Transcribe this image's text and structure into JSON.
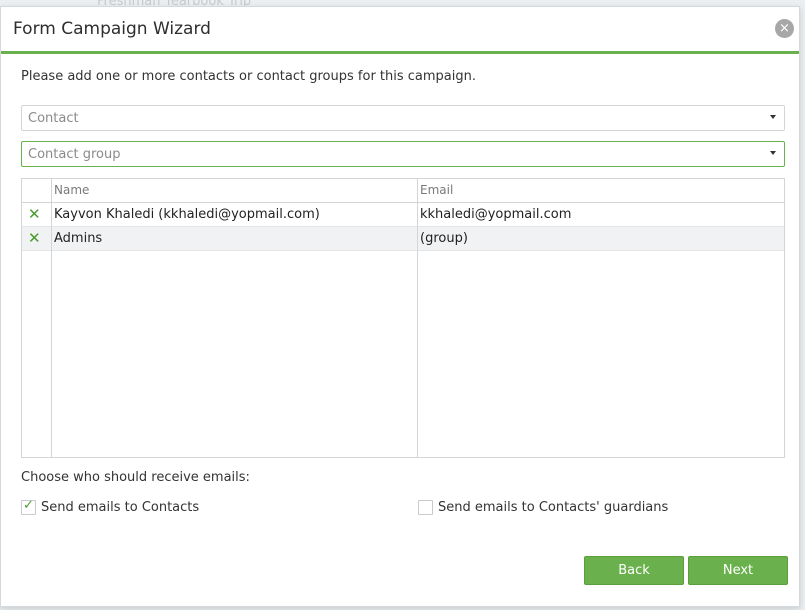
{
  "background_text": "Freshman Yearbook Trip",
  "dialog": {
    "title": "Form Campaign Wizard",
    "close_glyph": "×"
  },
  "intro_text": "Please add one or more contacts or contact groups for this campaign.",
  "contact_combo": {
    "placeholder": "Contact"
  },
  "group_combo": {
    "placeholder": "Contact group"
  },
  "grid": {
    "columns": [
      "Name",
      "Email"
    ],
    "rows": [
      {
        "name": "Kayvon Khaledi (kkhaledi@yopmail.com)",
        "email": "kkhaledi@yopmail.com"
      },
      {
        "name": "Admins",
        "email": "(group)"
      }
    ],
    "remove_glyph": "✕"
  },
  "recipients": {
    "label": "Choose who should receive emails:",
    "send_contacts": {
      "label": "Send emails to Contacts",
      "checked": true
    },
    "send_guardians": {
      "label": "Send emails to Contacts' guardians",
      "checked": false
    },
    "check_glyph": "✓"
  },
  "buttons": {
    "back": "Back",
    "next": "Next"
  },
  "colors": {
    "accent": "#6ab04c",
    "remove_icon": "#4a9a2e"
  }
}
